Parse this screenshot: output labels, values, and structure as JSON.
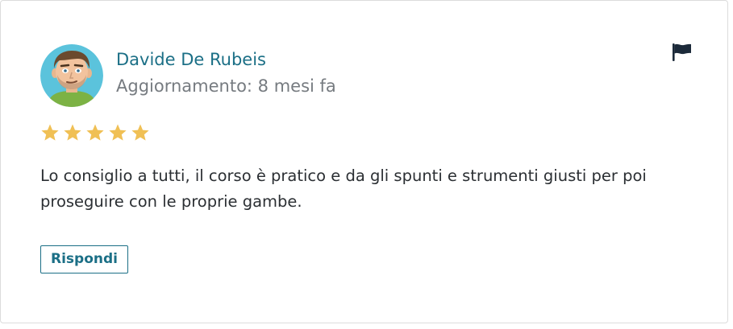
{
  "review": {
    "author_name": "Davide De Rubeis",
    "updated_text": "Aggiornamento: 8 mesi fa",
    "rating": 5,
    "rating_max": 5,
    "body": "Lo consiglio a tutti, il corso è pratico e da gli spunti e strumenti giusti per poi proseguire con le proprie gambe.",
    "reply_label": "Rispondi"
  },
  "icons": {
    "flag": "flag-icon",
    "star": "star-icon",
    "avatar": "avatar-illustration"
  },
  "colors": {
    "link": "#1b6f86",
    "muted_text": "#767b80",
    "body_text": "#2b2f33",
    "star": "#f0c055",
    "flag": "#1c2a3a",
    "avatar_bg": "#5bc3dc",
    "avatar_shirt": "#7cb244"
  }
}
